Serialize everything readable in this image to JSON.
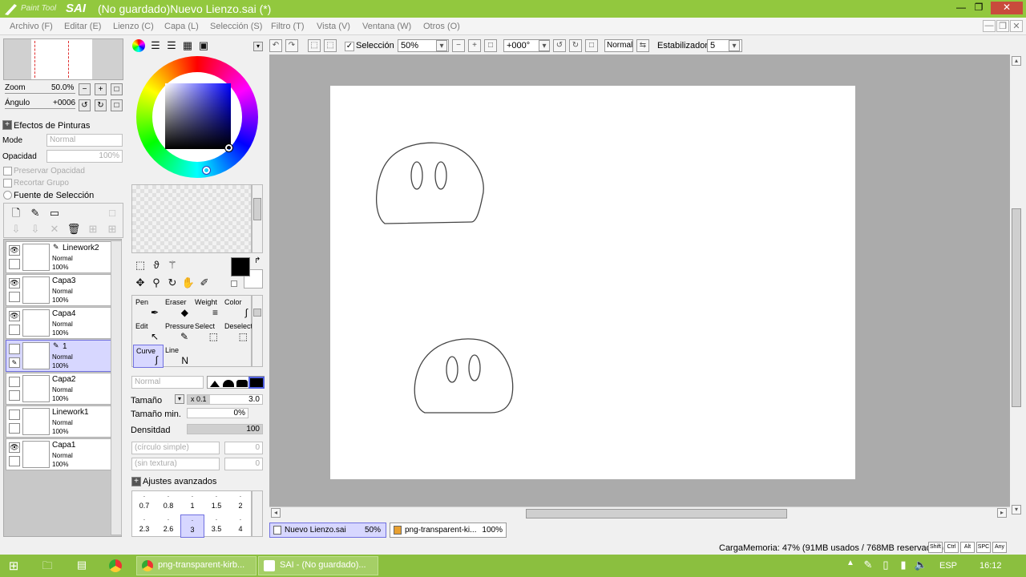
{
  "app": {
    "logo_small": "Paint Tool",
    "logo_big": "SAI",
    "title": "(No guardado)Nuevo Lienzo.sai (*)",
    "minimize": "—",
    "restore": "❐",
    "close": "✕"
  },
  "menu": [
    "Archivo (F)",
    "Editar (E)",
    "Lienzo (C)",
    "Capa (L)",
    "Selección (S)",
    "Filtro (T)",
    "Vista (V)",
    "Ventana (W)",
    "Otros (O)"
  ],
  "navigator": {
    "zoom_label": "Zoom",
    "zoom_value": "50.0%",
    "angle_label": "Ángulo",
    "angle_value": "+0006"
  },
  "effects": {
    "header": "Efectos de Pinturas",
    "mode_label": "Mode",
    "mode_value": "Normal",
    "opacity_label": "Opacidad",
    "opacity_value": "100%",
    "preserve": "Preservar Opacidad",
    "clip": "Recortar Grupo",
    "selection_source": "Fuente de Selección"
  },
  "layers": [
    {
      "name": "Linework2",
      "mode": "Normal",
      "opacity": "100%",
      "visible": true,
      "selected": false,
      "icon": "pen"
    },
    {
      "name": "Capa3",
      "mode": "Normal",
      "opacity": "100%",
      "visible": true,
      "selected": false,
      "icon": ""
    },
    {
      "name": "Capa4",
      "mode": "Normal",
      "opacity": "100%",
      "visible": true,
      "selected": false,
      "icon": ""
    },
    {
      "name": "1",
      "mode": "Normal",
      "opacity": "100%",
      "visible": false,
      "selected": true,
      "icon": "pen"
    },
    {
      "name": "Capa2",
      "mode": "Normal",
      "opacity": "100%",
      "visible": false,
      "selected": false,
      "icon": ""
    },
    {
      "name": "Linework1",
      "mode": "Normal",
      "opacity": "100%",
      "visible": false,
      "selected": false,
      "icon": ""
    },
    {
      "name": "Capa1",
      "mode": "Normal",
      "opacity": "100%",
      "visible": true,
      "selected": false,
      "icon": ""
    }
  ],
  "colors": {
    "foreground": "#000000",
    "background": "#ffffff",
    "accent": "#92c83e"
  },
  "brushes": [
    {
      "label": "Pen",
      "glyph": "✒"
    },
    {
      "label": "Eraser",
      "glyph": "◆"
    },
    {
      "label": "Weight",
      "glyph": "≡"
    },
    {
      "label": "Color",
      "glyph": "∫"
    },
    {
      "label": "Edit",
      "glyph": "↖"
    },
    {
      "label": "Pressure",
      "glyph": "✎"
    },
    {
      "label": "Select",
      "glyph": "⬚"
    },
    {
      "label": "Deselect",
      "glyph": "⬚"
    },
    {
      "label": "Curve",
      "glyph": "∫"
    },
    {
      "label": "Line",
      "glyph": "Ν"
    }
  ],
  "brush_settings": {
    "blend_mode": "Normal",
    "size_label": "Tamaño",
    "size_mult": "x 0.1",
    "size_value": "3.0",
    "min_size_label": "Tamaño min.",
    "min_size_value": "0%",
    "density_label": "Densitdad",
    "density_value": "100",
    "shape": "(círculo simple)",
    "shape_value": "0",
    "texture": "(sin textura)",
    "texture_value": "0",
    "advanced": "Ajustes avanzados"
  },
  "size_presets_row1": [
    "0.7",
    "0.8",
    "1",
    "1.5",
    "2"
  ],
  "size_presets_row2": [
    "2.3",
    "2.6",
    "3",
    "3.5",
    "4"
  ],
  "toolbar": {
    "selection_label": "Selección",
    "zoom_value": "50%",
    "angle_value": "+000°",
    "blend_value": "Normal",
    "stabilizer_label": "Estabilizador",
    "stabilizer_value": "5"
  },
  "doc_tabs": [
    {
      "name": "Nuevo Lienzo.sai",
      "zoom": "50%"
    },
    {
      "name": "png-transparent-ki...",
      "zoom": "100%"
    }
  ],
  "status": {
    "memory": "CargaMemoria: 47% (91MB usados / 768MB reservados)",
    "keys": [
      "Shift",
      "Ctrl",
      "Alt",
      "SPC",
      "Any"
    ]
  },
  "taskbar": {
    "items": [
      "png-transparent-kirb...",
      "SAI - (No guardado)..."
    ],
    "lang": "ESP",
    "time": "16:12"
  }
}
